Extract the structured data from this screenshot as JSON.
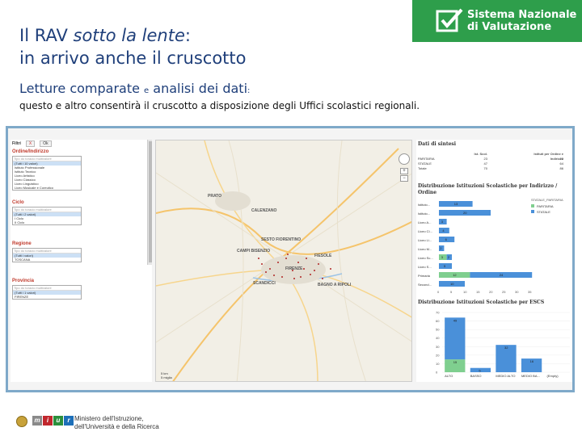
{
  "header": {
    "title_line1_prefix": "Il RAV ",
    "title_line1_italic": "sotto la lente",
    "title_line1_suffix": ":",
    "title_line2": "in arrivo anche il cruscotto",
    "brand_line1": "Sistema Nazionale",
    "brand_line2": "di Valutazione",
    "brand_icon": "checkbox-icon",
    "brand_color": "#2e9e4b"
  },
  "subtitle": {
    "part1": "Letture comparate ",
    "part2": "e",
    "part3": " analisi dei dati",
    "part4": ":"
  },
  "description": "questo e altro consentirà il cruscotto a disposizione degli Uffici scolastici regionali.",
  "dashboard": {
    "filters": {
      "label": "Filtri",
      "btn_x": "X",
      "btn_ok": "Ok",
      "sections": [
        {
          "title": "Ordine/Indirizzo",
          "placeholder": "Tipo do toracio multivalore",
          "options": [
            "(Tutti i 10 valori)",
            "Istituto Professionale",
            "Istituto Tecnico",
            "Liceo Artistico",
            "Liceo Classico",
            "Liceo Linguistico",
            "Liceo Musicale e Coreutico"
          ]
        },
        {
          "title": "Ciclo",
          "placeholder": "Tipo do toracio multivalore",
          "options": [
            "(Tutti i 2 valori)",
            "I Ciclo",
            "II Ciclo"
          ]
        },
        {
          "title": "Regione",
          "placeholder": "Tipo do toracio multivalore",
          "options": [
            "(Tutti i valori)",
            "TOSCANA"
          ]
        },
        {
          "title": "Provincia",
          "placeholder": "Tipo do toracio multivalore",
          "options": [
            "(Tutti i 1 valori)",
            "FIRENZE"
          ]
        }
      ]
    },
    "map": {
      "labels": [
        "PRATO",
        "FIRENZE",
        "CALENZANO",
        "SCANDICCI",
        "FIESOLE",
        "BAGNO A RIPOLI",
        "SESTO FIORENTINO",
        "CAMPI BISENZIO"
      ],
      "scale_km": "5 km",
      "scale_mi": "5 miglia"
    },
    "summary": {
      "title": "Dati di sintesi",
      "col_type": "Ist. Scol.",
      "col_indirizzo": "Istituti per Ordine e Indirizzo",
      "rows": [
        {
          "type": "PARITARIA",
          "count": "23",
          "count2": "22"
        },
        {
          "type": "STATALE",
          "count": "47",
          "count2": "64"
        },
        {
          "type": "Totale",
          "count": "70",
          "count2": "86"
        }
      ]
    },
    "legend": {
      "title": "Colore per",
      "subtitle": "STATALE_PARITARIA",
      "items": [
        {
          "label": "PARITARIA",
          "color": "#7fcf8f"
        },
        {
          "label": "STATALE",
          "color": "#4a90d9"
        }
      ]
    }
  },
  "chart_data": [
    {
      "type": "bar",
      "orientation": "horizontal",
      "title": "Distribuzione Istituzioni Scolastiche per Indirizzo / Ordine",
      "categories": [
        "Istituto...",
        "Istituto...",
        "Liceo A...",
        "Liceo Cl...",
        "Liceo Li...",
        "Liceo M...",
        "Liceo Sc...",
        "Liceo S...",
        "Primaria",
        "Second..."
      ],
      "series": [
        {
          "name": "PARITARIA",
          "values": [
            0,
            0,
            0,
            0,
            0,
            0,
            3,
            0,
            12,
            0
          ]
        },
        {
          "name": "STATALE",
          "values": [
            13,
            20,
            3,
            4,
            6,
            2,
            2,
            5,
            24,
            10
          ]
        }
      ],
      "xlim": [
        0,
        35
      ],
      "xticks": [
        "0",
        "5",
        "10",
        "15",
        "20",
        "25",
        "30",
        "35"
      ]
    },
    {
      "type": "bar",
      "title": "Distribuzione Istituzioni Scolastiche per ESCS",
      "categories": [
        "ALTO",
        "BASSO",
        "MEDIO ALTO",
        "MEDIO BA...",
        "(Empty)"
      ],
      "series": [
        {
          "name": "PARITARIA",
          "values": [
            15,
            0,
            0,
            0,
            0
          ]
        },
        {
          "name": "STATALE",
          "values": [
            49,
            5,
            32,
            16,
            0
          ]
        }
      ],
      "ylim": [
        0,
        70
      ],
      "yticks": [
        "0",
        "10",
        "20",
        "30",
        "40",
        "50",
        "60",
        "70"
      ]
    }
  ],
  "footer": {
    "ministry_line1": "Ministero dell'Istruzione,",
    "ministry_line2": "dell'Università e della Ricerca",
    "squares": [
      {
        "letter": "m",
        "color": "#8a8a8a"
      },
      {
        "letter": "i",
        "color": "#c1272d"
      },
      {
        "letter": "u",
        "color": "#2b8f3c"
      },
      {
        "letter": "r",
        "color": "#1d6fb8"
      }
    ]
  }
}
